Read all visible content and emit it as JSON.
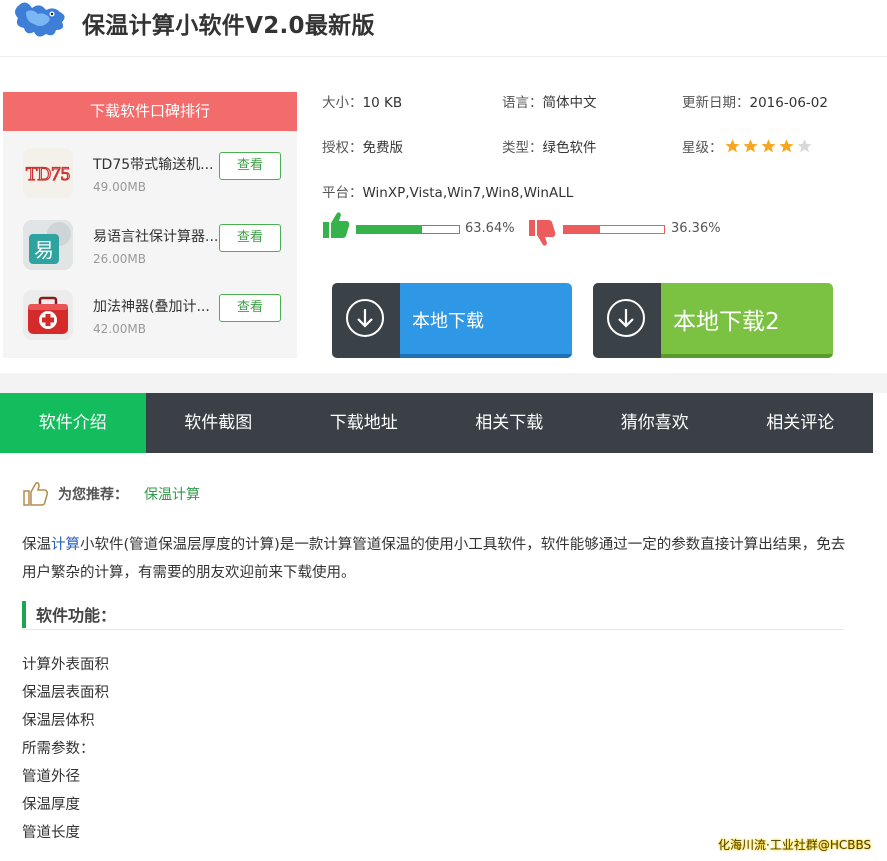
{
  "header": {
    "title": "保温计算小软件V2.0最新版"
  },
  "ranking": {
    "title": "下载软件口碑排行",
    "items": [
      {
        "name": "TD75带式输送机...",
        "size": "49.00MB",
        "button": "查看",
        "icon_text": "TD75"
      },
      {
        "name": "易语言社保计算器...",
        "size": "26.00MB",
        "button": "查看",
        "icon_text": "易"
      },
      {
        "name": "加法神器(叠加计...",
        "size": "42.00MB",
        "button": "查看",
        "icon_text": ""
      }
    ]
  },
  "info": {
    "size_label": "大小：",
    "size_value": "10 KB",
    "lang_label": "语言：",
    "lang_value": "简体中文",
    "date_label": "更新日期：",
    "date_value": "2016-06-02",
    "license_label": "授权：",
    "license_value": "免费版",
    "type_label": "类型：",
    "type_value": "绿色软件",
    "rating_label": "星级：",
    "rating_stars": 4,
    "rating_max": 5,
    "platform_label": "平台：",
    "platform_value": "WinXP,Vista,Win7,Win8,WinALL"
  },
  "votes": {
    "up_pct": "63.64%",
    "up_fraction": 0.6364,
    "down_pct": "36.36%",
    "down_fraction": 0.3636
  },
  "downloads": {
    "local": "本地下载",
    "local2": "本地下载2"
  },
  "tabs": [
    "软件介绍",
    "软件截图",
    "下载地址",
    "相关下载",
    "猜你喜欢",
    "相关评论"
  ],
  "recommend": {
    "label": "为您推荐：",
    "link": "保温计算"
  },
  "description": {
    "pre": "保温",
    "highlight": "计算",
    "post": "小软件(管道保温层厚度的计算)是一款计算管道保温的使用小工具软件，软件能够通过一定的参数直接计算出结果，免去用户繁杂的计算，有需要的朋友欢迎前来下载使用。"
  },
  "features": {
    "title": "软件功能：",
    "items": [
      "计算外表面积",
      "保温层表面积",
      "保温层体积",
      "所需参数：",
      "管道外径",
      "保温厚度",
      "管道长度"
    ]
  },
  "watermark": "化海川流·工业社群@HCBBS",
  "colors": {
    "rank_header": "#f26c6c",
    "active_tab": "#13bd5e",
    "tab_bar": "#3a4046",
    "dl_blue": "#2f98e6",
    "dl_green": "#7cc242",
    "up_green": "#36b24a",
    "down_red": "#ec5c5c",
    "star": "#f5a623"
  }
}
